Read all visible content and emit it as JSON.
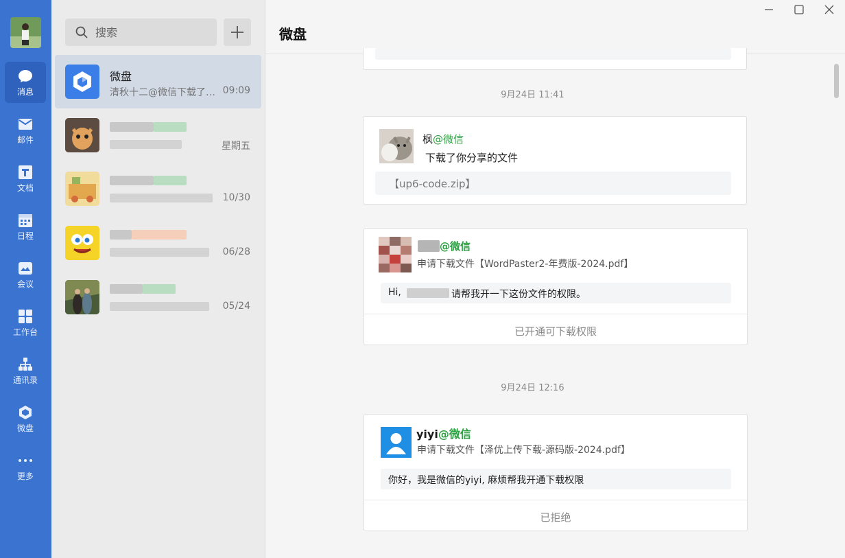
{
  "nav": {
    "items": [
      {
        "label": "消息",
        "icon": "chat-bubble-icon"
      },
      {
        "label": "邮件",
        "icon": "mail-icon"
      },
      {
        "label": "文档",
        "icon": "document-icon"
      },
      {
        "label": "日程",
        "icon": "calendar-icon"
      },
      {
        "label": "会议",
        "icon": "meeting-icon"
      },
      {
        "label": "工作台",
        "icon": "grid-icon"
      },
      {
        "label": "通讯录",
        "icon": "org-chart-icon"
      },
      {
        "label": "微盘",
        "icon": "cloud-drive-icon"
      },
      {
        "label": "更多",
        "icon": "more-dots-icon"
      }
    ]
  },
  "search": {
    "placeholder": "搜索"
  },
  "conversations": [
    {
      "name": "微盘",
      "preview": "清秋十二@微信下载了你分享的文件",
      "time": "09:09"
    },
    {
      "name": "",
      "preview": "",
      "time": "星期五"
    },
    {
      "name": "",
      "preview": "",
      "time": "10/30"
    },
    {
      "name": "",
      "preview": "",
      "time": "06/28"
    },
    {
      "name": "",
      "preview": "",
      "time": "05/24"
    }
  ],
  "chat": {
    "title": "微盘",
    "messages": [
      {
        "timestamp": "9月24日 11:41",
        "sender": "枫",
        "sender_suffix": "@微信",
        "line": "下载了你分享的文件",
        "file": "【up6-code.zip】"
      },
      {
        "sender": "",
        "sender_suffix": "@微信",
        "line": "申请下载文件【WordPaster2-年费版-2024.pdf】",
        "greeting_prefix": "Hi,",
        "greeting_suffix": "请帮我开一下这份文件的权限。",
        "action": "已开通可下载权限"
      },
      {
        "timestamp": "9月24日 12:16",
        "sender": "yiyi",
        "sender_suffix": "@微信",
        "line": "申请下载文件【泽优上传下载-源码版-2024.pdf】",
        "greeting": "你好，我是微信的yiyi, 麻烦帮我开通下载权限",
        "action": "已拒绝"
      }
    ]
  },
  "colors": {
    "nav_bg": "#3b73d0",
    "accent_green": "#2ea043"
  }
}
